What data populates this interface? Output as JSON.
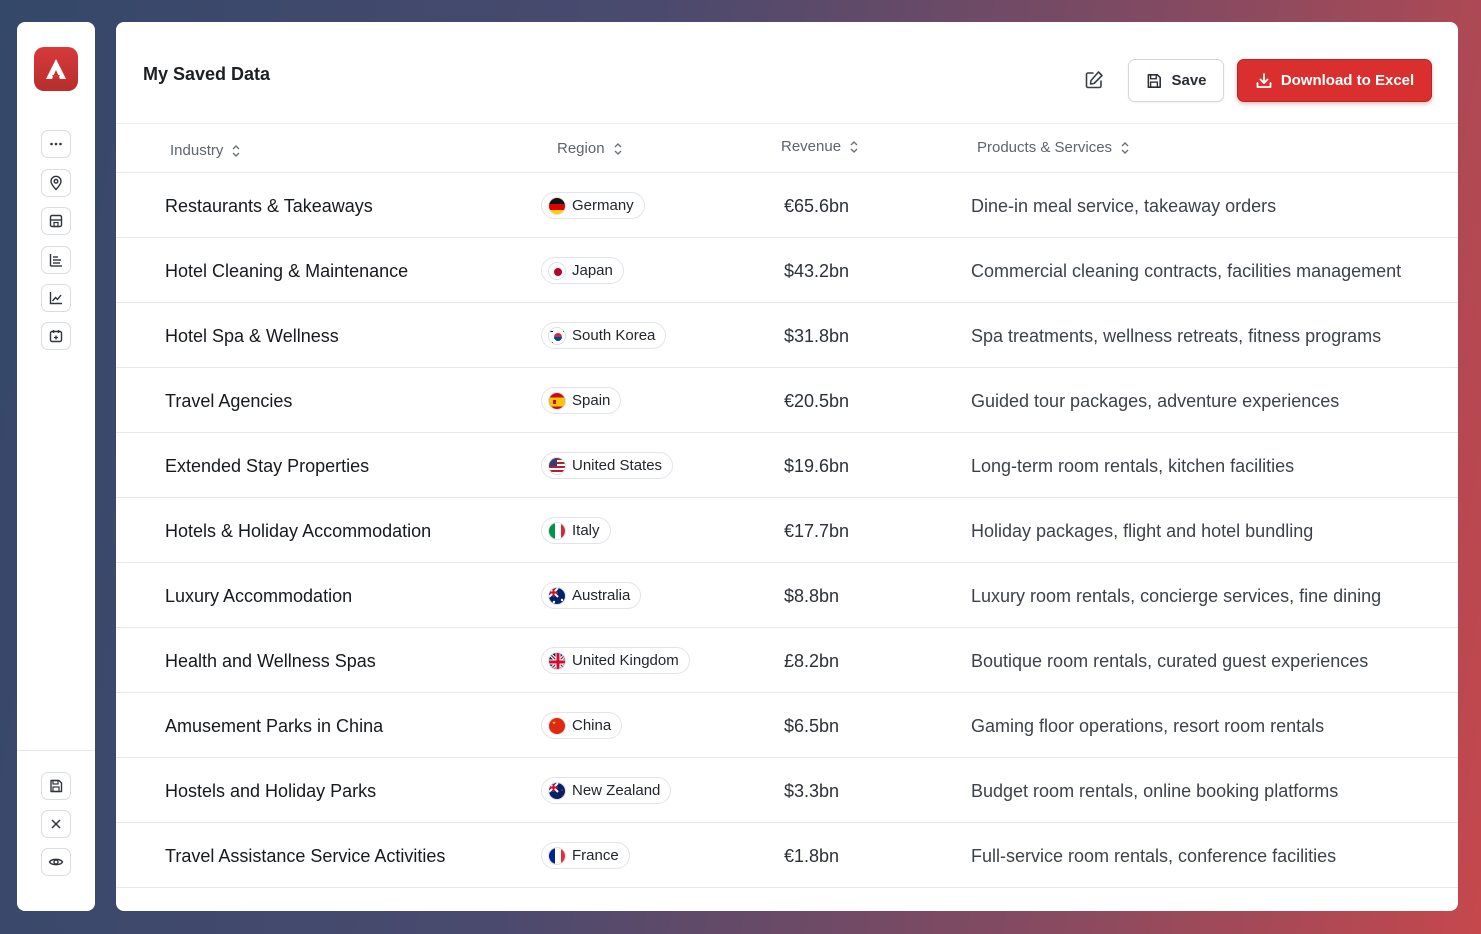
{
  "sidebar": {
    "buttons": [
      {
        "icon": "more-icon"
      },
      {
        "icon": "map-pin-icon"
      },
      {
        "icon": "building-icon"
      },
      {
        "icon": "bar-chart-icon"
      },
      {
        "icon": "line-chart-icon"
      },
      {
        "icon": "calendar-plus-icon"
      }
    ],
    "bottom_buttons": [
      {
        "icon": "save-icon"
      },
      {
        "icon": "close-icon"
      },
      {
        "icon": "eye-icon"
      }
    ]
  },
  "header": {
    "title": "My Saved Data",
    "save_label": "Save",
    "download_label": "Download to Excel"
  },
  "table": {
    "columns": [
      "Industry",
      "Region",
      "Revenue",
      "Products & Services"
    ],
    "rows": [
      {
        "industry": "Restaurants & Takeaways",
        "region": "Germany",
        "flag": "de",
        "revenue": "€65.6bn",
        "products": "Dine-in meal service, takeaway orders"
      },
      {
        "industry": "Hotel Cleaning & Maintenance",
        "region": "Japan",
        "flag": "jp",
        "revenue": "$43.2bn",
        "products": "Commercial cleaning contracts, facilities management"
      },
      {
        "industry": "Hotel Spa & Wellness",
        "region": "South Korea",
        "flag": "kr",
        "revenue": "$31.8bn",
        "products": "Spa treatments, wellness retreats, fitness programs"
      },
      {
        "industry": "Travel Agencies",
        "region": "Spain",
        "flag": "es",
        "revenue": "€20.5bn",
        "products": "Guided tour packages, adventure experiences"
      },
      {
        "industry": "Extended Stay Properties",
        "region": "United States",
        "flag": "us",
        "revenue": "$19.6bn",
        "products": "Long-term room rentals, kitchen facilities"
      },
      {
        "industry": "Hotels & Holiday Accommodation",
        "region": "Italy",
        "flag": "it",
        "revenue": "€17.7bn",
        "products": "Holiday packages, flight and hotel bundling"
      },
      {
        "industry": "Luxury Accommodation",
        "region": "Australia",
        "flag": "au",
        "revenue": "$8.8bn",
        "products": "Luxury room rentals, concierge services, fine dining"
      },
      {
        "industry": "Health and Wellness Spas",
        "region": "United Kingdom",
        "flag": "gb",
        "revenue": "£8.2bn",
        "products": "Boutique room rentals, curated guest experiences"
      },
      {
        "industry": "Amusement Parks in China",
        "region": "China",
        "flag": "cn",
        "revenue": "$6.5bn",
        "products": "Gaming floor operations, resort room rentals"
      },
      {
        "industry": "Hostels and Holiday Parks",
        "region": "New Zealand",
        "flag": "nz",
        "revenue": "$3.3bn",
        "products": "Budget room rentals, online booking platforms"
      },
      {
        "industry": "Travel Assistance Service Activities",
        "region": "France",
        "flag": "fr",
        "revenue": "€1.8bn",
        "products": "Full-service room rentals, conference facilities"
      }
    ]
  },
  "colors": {
    "accent": "#d9302f",
    "text": "#16191d",
    "muted": "#5e646d"
  }
}
